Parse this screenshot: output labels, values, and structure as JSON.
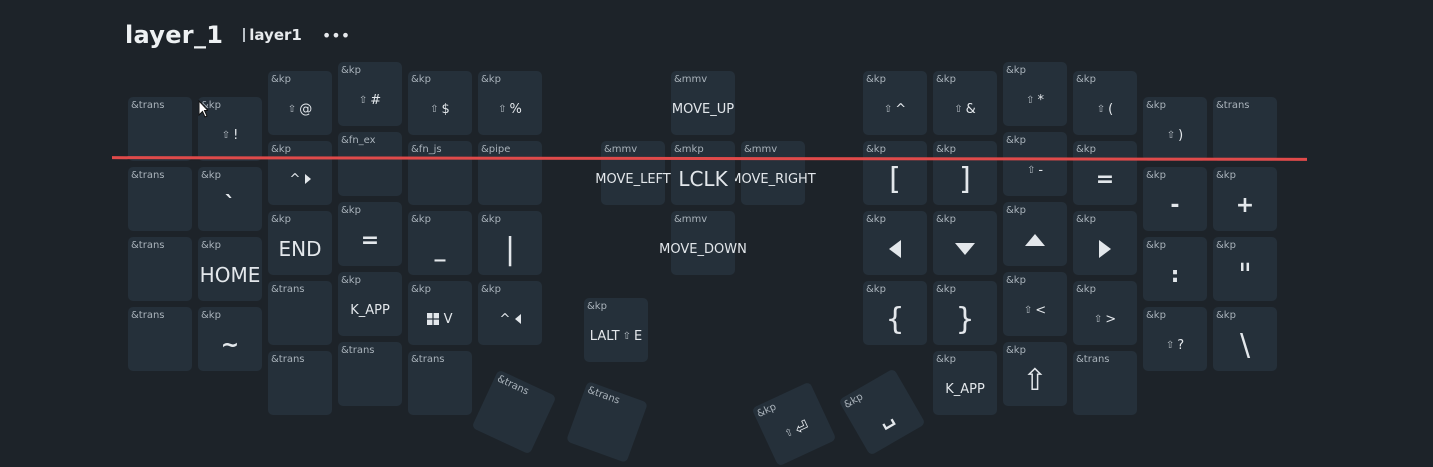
{
  "header": {
    "title": "layer_1",
    "subtitle": "layer1",
    "more_label": "•••"
  },
  "keys": {
    "l_c0_r0": {
      "b": "&trans",
      "l": ""
    },
    "l_c0_r1": {
      "b": "&trans",
      "l": ""
    },
    "l_c0_r2": {
      "b": "&trans",
      "l": ""
    },
    "l_c0_r3": {
      "b": "&trans",
      "l": ""
    },
    "l_c1_r0": {
      "b": "&kp",
      "l": "!"
    },
    "l_c1_r1": {
      "b": "&kp",
      "l": "`"
    },
    "l_c1_r2": {
      "b": "&kp",
      "l": "HOME"
    },
    "l_c1_r3": {
      "b": "&kp",
      "l": "~"
    },
    "l_c2_r0": {
      "b": "&kp",
      "l": "@"
    },
    "l_c2_r1": {
      "b": "&kp",
      "l": "^"
    },
    "l_c2_r2": {
      "b": "&kp",
      "l": "END"
    },
    "l_c2_r3": {
      "b": "&trans",
      "l": ""
    },
    "l_c2_r4": {
      "b": "&trans",
      "l": ""
    },
    "l_c3_r0": {
      "b": "&kp",
      "l": "#"
    },
    "l_c3_r1": {
      "b": "&fn_ex",
      "l": ""
    },
    "l_c3_r2": {
      "b": "&kp",
      "l": "="
    },
    "l_c3_r3": {
      "b": "&kp",
      "l": "K_APP"
    },
    "l_c3_r4": {
      "b": "&trans",
      "l": ""
    },
    "l_c4_r0": {
      "b": "&kp",
      "l": "$"
    },
    "l_c4_r1": {
      "b": "&fn_js",
      "l": ""
    },
    "l_c4_r2": {
      "b": "&kp",
      "l": "_"
    },
    "l_c4_r3": {
      "b": "&kp",
      "l": "V"
    },
    "l_c4_r4": {
      "b": "&trans",
      "l": ""
    },
    "l_c5_r0": {
      "b": "&kp",
      "l": "%"
    },
    "l_c5_r1": {
      "b": "&pipe",
      "l": ""
    },
    "l_c5_r2": {
      "b": "&kp",
      "l": "|"
    },
    "l_c5_r3": {
      "b": "&kp",
      "l": "^"
    },
    "l_thumb_a": {
      "b": "&kp",
      "l": "LALT",
      "l2": "E"
    },
    "l_thumb_b": {
      "b": "&trans",
      "l": ""
    },
    "l_thumb_c": {
      "b": "&trans",
      "l": ""
    },
    "m_up": {
      "b": "&mmv",
      "l": "MOVE_UP"
    },
    "m_left": {
      "b": "&mmv",
      "l": "MOVE_LEFT"
    },
    "m_center": {
      "b": "&mkp",
      "l": "LCLK"
    },
    "m_right": {
      "b": "&mmv",
      "l": "MOVE_RIGHT"
    },
    "m_down": {
      "b": "&mmv",
      "l": "MOVE_DOWN"
    },
    "r_c0_r0": {
      "b": "&kp",
      "l": "^"
    },
    "r_c0_r1": {
      "b": "&kp",
      "l": "["
    },
    "r_c0_r2": {
      "b": "&kp",
      "l": ""
    },
    "r_c0_r3": {
      "b": "&kp",
      "l": "{"
    },
    "r_c1_r0": {
      "b": "&kp",
      "l": "&"
    },
    "r_c1_r1": {
      "b": "&kp",
      "l": "]"
    },
    "r_c1_r2": {
      "b": "&kp",
      "l": ""
    },
    "r_c1_r3": {
      "b": "&kp",
      "l": "}"
    },
    "r_c1_r4": {
      "b": "&kp",
      "l": "K_APP"
    },
    "r_c2_r0": {
      "b": "&kp",
      "l": "*"
    },
    "r_c2_r1": {
      "b": "&kp",
      "l": "-"
    },
    "r_c2_r2": {
      "b": "&kp",
      "l": ""
    },
    "r_c2_r3": {
      "b": "&kp",
      "l": "<"
    },
    "r_c2_r4": {
      "b": "&kp",
      "l": "⇧"
    },
    "r_c3_r0": {
      "b": "&kp",
      "l": "("
    },
    "r_c3_r1": {
      "b": "&kp",
      "l": "="
    },
    "r_c3_r2": {
      "b": "&kp",
      "l": ""
    },
    "r_c3_r3": {
      "b": "&kp",
      "l": ">"
    },
    "r_c3_r4": {
      "b": "&trans",
      "l": ""
    },
    "r_c4_r0": {
      "b": "&kp",
      "l": ")"
    },
    "r_c4_r1": {
      "b": "&kp",
      "l": "-"
    },
    "r_c4_r2": {
      "b": "&kp",
      "l": ":"
    },
    "r_c4_r3": {
      "b": "&kp",
      "l": "?"
    },
    "r_c5_r0": {
      "b": "&trans",
      "l": ""
    },
    "r_c5_r1": {
      "b": "&kp",
      "l": "+"
    },
    "r_c5_r2": {
      "b": "&kp",
      "l": "\""
    },
    "r_c5_r3": {
      "b": "&kp",
      "l": "\\"
    },
    "r_thumb_a": {
      "b": "&kp",
      "l": ""
    },
    "r_thumb_b": {
      "b": "&kp",
      "l": ""
    }
  },
  "colors": {
    "background": "#1d2329",
    "key": "#25303a",
    "overlay_line": "#e04a4a"
  }
}
